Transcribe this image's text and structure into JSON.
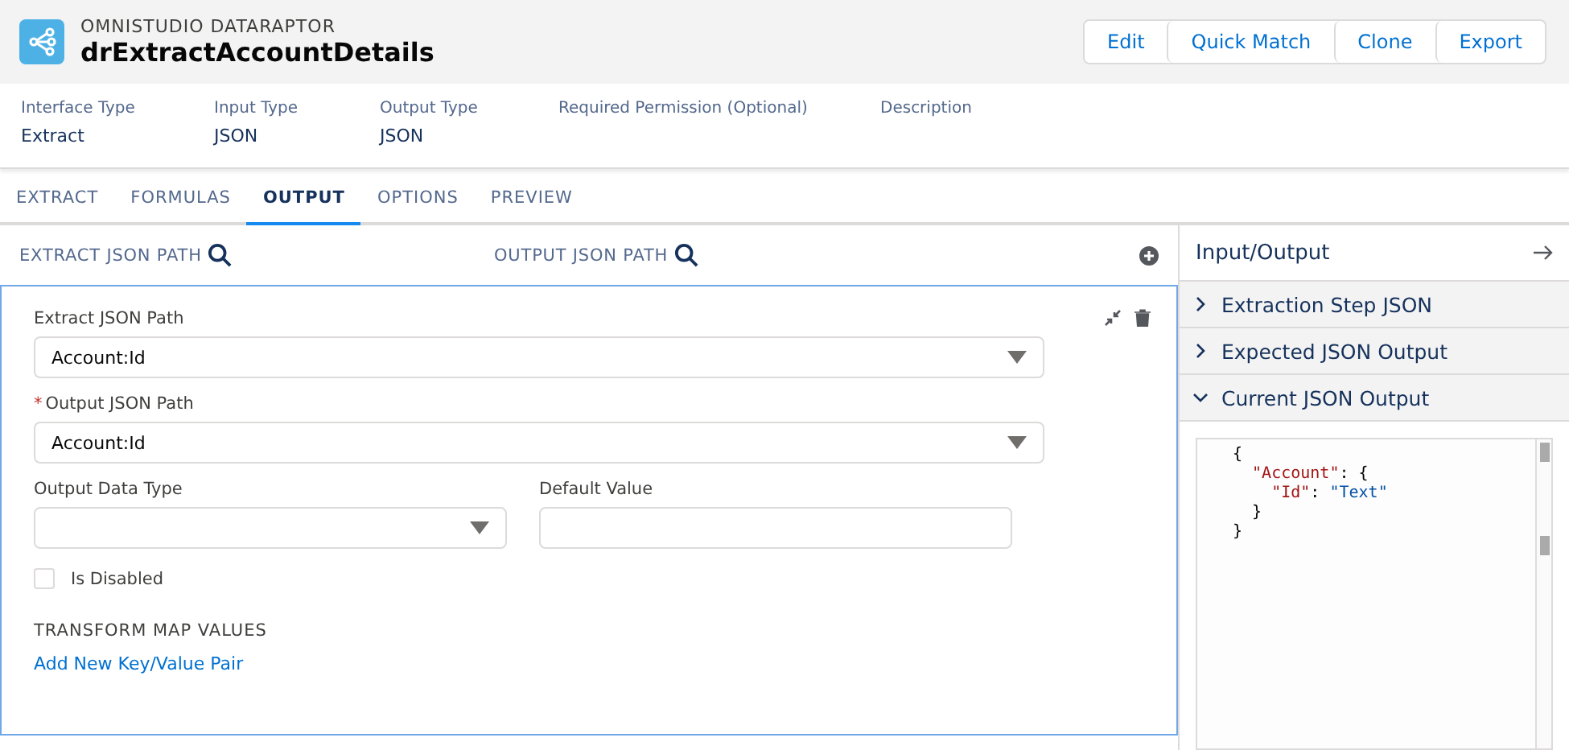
{
  "header": {
    "eyebrow": "OMNISTUDIO DATARAPTOR",
    "title": "drExtractAccountDetails",
    "actions": [
      "Edit",
      "Quick Match",
      "Clone",
      "Export"
    ]
  },
  "details": [
    {
      "label": "Interface Type",
      "value": "Extract"
    },
    {
      "label": "Input Type",
      "value": "JSON"
    },
    {
      "label": "Output Type",
      "value": "JSON"
    },
    {
      "label": "Required Permission (Optional)"
    },
    {
      "label": "Description"
    }
  ],
  "tabs": [
    {
      "label": "EXTRACT",
      "selected": false
    },
    {
      "label": "FORMULAS",
      "selected": false
    },
    {
      "label": "OUTPUT",
      "selected": true
    },
    {
      "label": "OPTIONS",
      "selected": false
    },
    {
      "label": "PREVIEW",
      "selected": false
    }
  ],
  "mapping_header": {
    "extract_label": "EXTRACT JSON PATH",
    "output_label": "OUTPUT JSON PATH"
  },
  "mapping": {
    "extract_path": {
      "label": "Extract JSON Path",
      "value": "Account:Id",
      "required": false
    },
    "output_path": {
      "label": "Output JSON Path",
      "value": "Account:Id",
      "required": true
    },
    "output_data_type": {
      "label": "Output Data Type"
    },
    "default_value": {
      "label": "Default Value"
    },
    "is_disabled": {
      "label": "Is Disabled",
      "checked": false
    },
    "transform_heading": "TRANSFORM MAP VALUES",
    "add_pair_link": "Add New Key/Value Pair",
    "required_mark": "*"
  },
  "side_panel": {
    "title": "Input/Output",
    "sections": [
      {
        "label": "Extraction Step JSON",
        "expanded": false
      },
      {
        "label": "Expected JSON Output",
        "expanded": false
      },
      {
        "label": "Current JSON Output",
        "expanded": true
      }
    ],
    "code_lines": [
      [
        {
          "kind": "punct",
          "text": "{"
        }
      ],
      [
        {
          "kind": "key",
          "text": "  \"Account\""
        },
        {
          "kind": "punct",
          "text": ": {"
        }
      ],
      [
        {
          "kind": "key",
          "text": "    \"Id\""
        },
        {
          "kind": "punct",
          "text": ": "
        },
        {
          "kind": "string",
          "text": "\"Text\""
        }
      ],
      [
        {
          "kind": "punct",
          "text": "  }"
        }
      ],
      [
        {
          "kind": "punct",
          "text": "}"
        }
      ]
    ]
  }
}
